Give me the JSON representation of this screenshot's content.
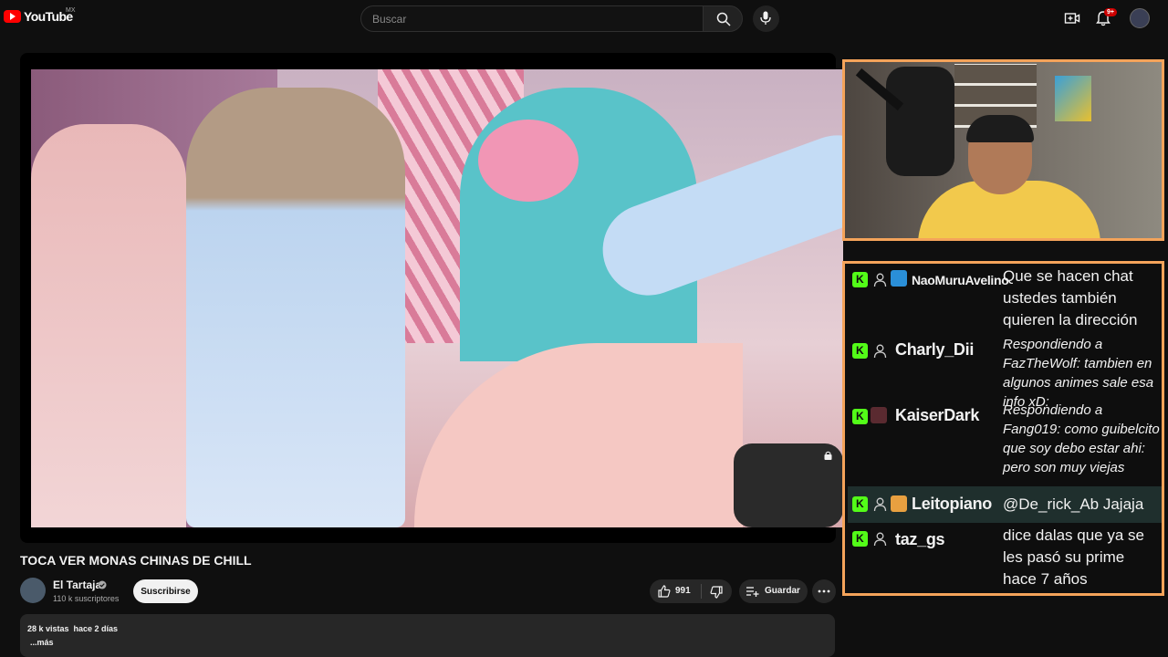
{
  "header": {
    "logo_text": "YouTube",
    "country": "MX",
    "search_placeholder": "Buscar",
    "notifications_badge": "9+"
  },
  "video": {
    "title": "TOCA VER MONAS CHINAS DE CHILL",
    "channel": {
      "name": "El Tartaja",
      "subscribers": "110 k suscriptores"
    },
    "subscribe_label": "Suscribirse",
    "likes": "991",
    "save_label": "Guardar",
    "description": {
      "stats": "28 k vistas  hace 2 días",
      "more": "...más"
    }
  },
  "chat": {
    "messages": [
      {
        "user": "NaoMuruAvelino",
        "text": "Que se hacen chat ustedes también quieren la dirección",
        "avatar": true,
        "avatar_color": "#2a8fd8"
      },
      {
        "user": "Charly_Dii",
        "text": "Respondiendo a FazTheWolf: tambien en algunos animes sale esa info xD:",
        "avatar": false
      },
      {
        "user": "KaiserDark",
        "text": "Respondiendo a Fang019: como guibelcito que soy debo estar ahi:  pero son muy viejas",
        "avatar": true,
        "avatar_color": "#5a2a30"
      },
      {
        "user": "Leitopiano",
        "text": "@De_rick_Ab Jajaja",
        "avatar": true,
        "avatar_color": "#e8a040"
      },
      {
        "user": "taz_gs",
        "text": "dice dalas que ya se les pasó su prime hace 7 años",
        "avatar": false
      }
    ]
  },
  "colors": {
    "accent_orange": "#f4a35a",
    "kick_green": "#53fc18",
    "youtube_red": "#ff0000",
    "background": "#0f0f0f"
  },
  "icons": [
    "search-icon",
    "microphone-icon",
    "create-video-icon",
    "bell-icon",
    "like-icon",
    "dislike-icon",
    "playlist-add-icon",
    "more-icon",
    "verified-icon",
    "kick-icon",
    "person-icon",
    "lock-icon"
  ]
}
